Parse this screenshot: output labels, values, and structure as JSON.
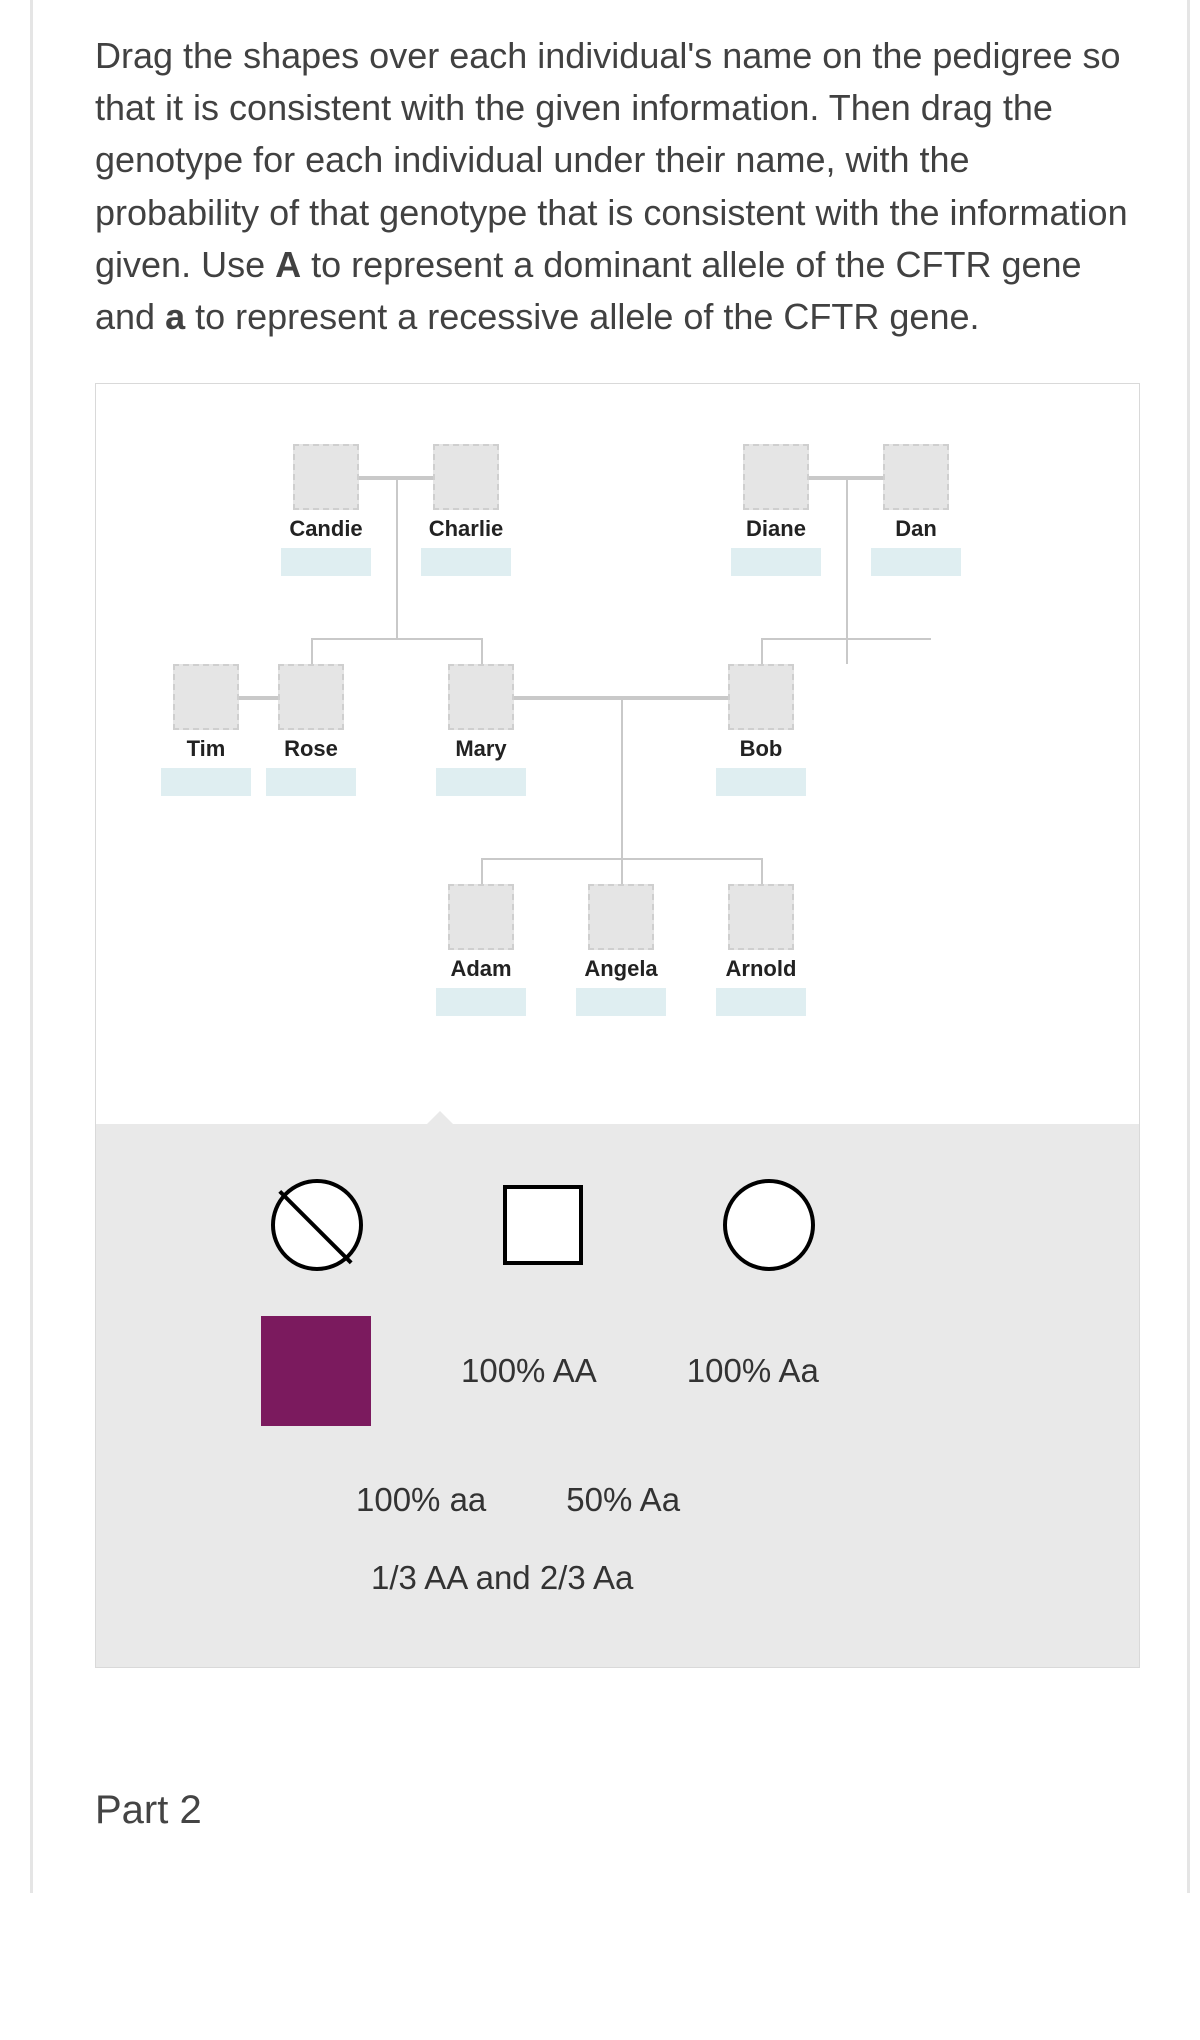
{
  "instructions": {
    "pre_A": "Drag the shapes over each individual's name on the pedigree so that it is consistent with the given information. Then drag the genotype for each individual under their name, with the probability of that genotype that is consistent with the information given. Use ",
    "bold_A": "A",
    "mid": " to represent a dominant allele of the CFTR gene and ",
    "bold_a": "a",
    "post": " to represent a recessive allele of the CFTR gene."
  },
  "individuals": {
    "candie": "Candie",
    "charlie": "Charlie",
    "diane": "Diane",
    "dan": "Dan",
    "tim": "Tim",
    "rose": "Rose",
    "mary": "Mary",
    "bob": "Bob",
    "adam": "Adam",
    "angela": "Angela",
    "arnold": "Arnold"
  },
  "genotypes": {
    "g100AA": "100% AA",
    "g100Aa": "100% Aa",
    "g100aa": "100% aa",
    "g50Aa": "50% Aa",
    "gMix_pre": "1/3 AA ",
    "gMix_mid": "and",
    "gMix_post": " 2/3 Aa"
  },
  "footer": {
    "part2": "Part 2"
  }
}
